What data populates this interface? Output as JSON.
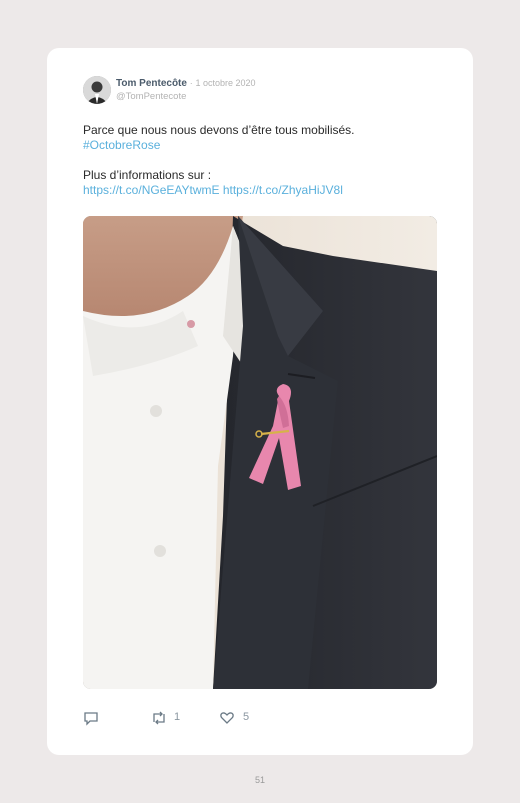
{
  "tweet": {
    "author_name": "Tom Pentecôte",
    "separator": "·",
    "date": "1 octobre 2020",
    "handle": "@TomPentecote",
    "line1": "Parce que nous nous devons d’être tous mobilisés.",
    "hashtag": "#OctobreRose",
    "line3": "Plus d’informations sur :",
    "link1": "https://t.co/NGeEAYtwmE",
    "link2": "https://t.co/ZhyaHiJV8l"
  },
  "actions": {
    "reply_icon": "speech-bubble-icon",
    "retweet_icon": "retweet-icon",
    "retweet_count": "1",
    "like_icon": "heart-icon",
    "like_count": "5"
  },
  "footer": {
    "page_number": "51"
  },
  "colors": {
    "link": "#5ab0dc",
    "ribbon": "#e887ad",
    "jacket": "#2b2d33"
  }
}
